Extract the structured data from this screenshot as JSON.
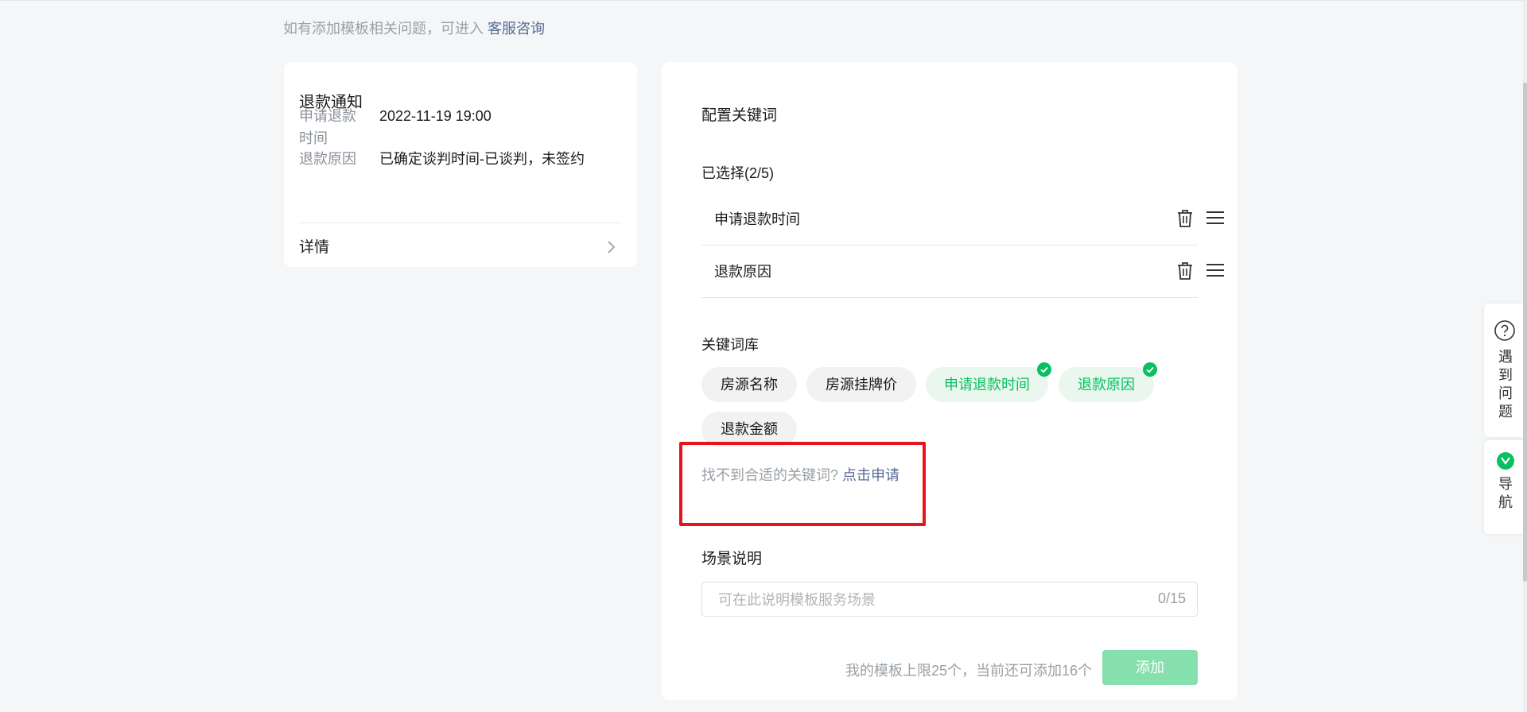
{
  "notice": {
    "text": "如有添加模板相关问题，可进入 ",
    "link": "客服咨询"
  },
  "preview": {
    "title": "退款通知",
    "fields": [
      {
        "label": "申请退款时间",
        "value": "2022-11-19 19:00"
      },
      {
        "label": "退款原因",
        "value": "已确定谈判时间-已谈判，未签约"
      }
    ],
    "detail": "详情"
  },
  "config": {
    "title": "配置关键词",
    "selected_title": "已选择(2/5)",
    "selected": [
      "申请退款时间",
      "退款原因"
    ],
    "library_title": "关键词库",
    "library": [
      {
        "label": "房源名称",
        "selected": false
      },
      {
        "label": "房源挂牌价",
        "selected": false
      },
      {
        "label": "申请退款时间",
        "selected": true
      },
      {
        "label": "退款原因",
        "selected": true
      },
      {
        "label": "退款金额",
        "selected": false
      }
    ],
    "apply_text": "找不到合适的关键词?",
    "apply_link": "点击申请",
    "scene_title": "场景说明",
    "scene_placeholder": "可在此说明模板服务场景",
    "scene_count": "0/15",
    "limit_text": "我的模板上限25个，当前还可添加16个",
    "add_label": "添加"
  },
  "sidebar": {
    "help_label": "遇到问题",
    "nav_label": "导航"
  },
  "colors": {
    "accent": "#07c160",
    "link": "#576b95",
    "highlight": "#e8141c",
    "add_disabled": "#86e0ad"
  }
}
